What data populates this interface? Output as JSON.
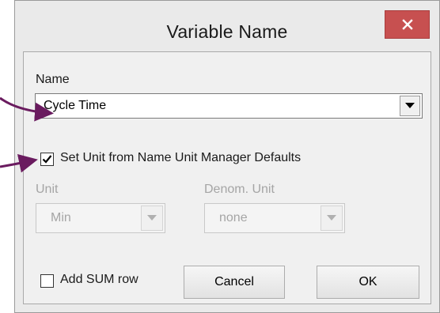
{
  "window": {
    "title": "Variable Name",
    "close_symbol": "×"
  },
  "form": {
    "name_label": "Name",
    "name_value": "Cycle Time",
    "set_unit_checkbox": {
      "label": "Set Unit from Name Unit Manager Defaults",
      "checked": true
    },
    "unit_label": "Unit",
    "unit_value": "Min",
    "denom_label": "Denom. Unit",
    "denom_value": "none",
    "add_sum_checkbox": {
      "label": "Add SUM row",
      "checked": false
    }
  },
  "buttons": {
    "cancel": "Cancel",
    "ok": "OK"
  },
  "icons": {
    "close": "close-icon",
    "dropdown": "chevron-down-icon",
    "check": "checkmark-icon"
  },
  "colors": {
    "close_button": "#c75050",
    "annotation_arrow": "#6a1b5f"
  }
}
